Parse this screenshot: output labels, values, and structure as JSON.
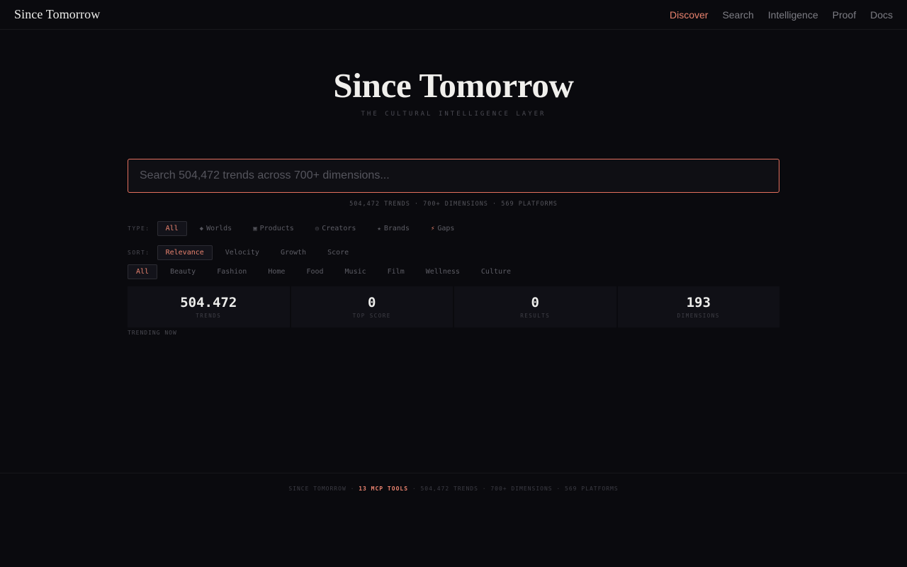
{
  "header": {
    "brand": "Since Tomorrow",
    "nav": [
      {
        "label": "Discover",
        "active": true
      },
      {
        "label": "Search"
      },
      {
        "label": "Intelligence"
      },
      {
        "label": "Proof"
      },
      {
        "label": "Docs"
      }
    ]
  },
  "hero": {
    "title": "Since Tomorrow",
    "subtitle": "THE CULTURAL INTELLIGENCE LAYER"
  },
  "search": {
    "placeholder": "Search 504,472 trends across 700+ dimensions...",
    "value": "",
    "stats_line": "504,472 TRENDS · 700+ DIMENSIONS · 569 PLATFORMS"
  },
  "filters": {
    "type_label": "TYPE:",
    "types": [
      {
        "label": "All",
        "icon": "",
        "active": true
      },
      {
        "label": "Worlds",
        "icon": "◆"
      },
      {
        "label": "Products",
        "icon": "▣"
      },
      {
        "label": "Creators",
        "icon": "◎"
      },
      {
        "label": "Brands",
        "icon": "★"
      },
      {
        "label": "Gaps",
        "icon": "⚡"
      }
    ],
    "sort_label": "SORT:",
    "sorts": [
      {
        "label": "Relevance",
        "active": true
      },
      {
        "label": "Velocity"
      },
      {
        "label": "Growth"
      },
      {
        "label": "Score"
      }
    ],
    "categories": [
      {
        "label": "All",
        "active": true
      },
      {
        "label": "Beauty"
      },
      {
        "label": "Fashion"
      },
      {
        "label": "Home"
      },
      {
        "label": "Food"
      },
      {
        "label": "Music"
      },
      {
        "label": "Film"
      },
      {
        "label": "Wellness"
      },
      {
        "label": "Culture"
      }
    ]
  },
  "stats": [
    {
      "value": "504.472",
      "label": "TRENDS"
    },
    {
      "value": "0",
      "label": "TOP SCORE"
    },
    {
      "value": "0",
      "label": "RESULTS"
    },
    {
      "value": "193",
      "label": "DIMENSIONS"
    }
  ],
  "trending": {
    "label": "TRENDING NOW"
  },
  "footer": {
    "prefix": "SINCE TOMORROW · ",
    "accent": "13 MCP TOOLS",
    "suffix": " · 504,472 TRENDS · 700+ DIMENSIONS · 569 PLATFORMS"
  },
  "colors": {
    "background": "#0a0a0e",
    "accent": "#e8826e",
    "search_border": "#e4705e"
  }
}
